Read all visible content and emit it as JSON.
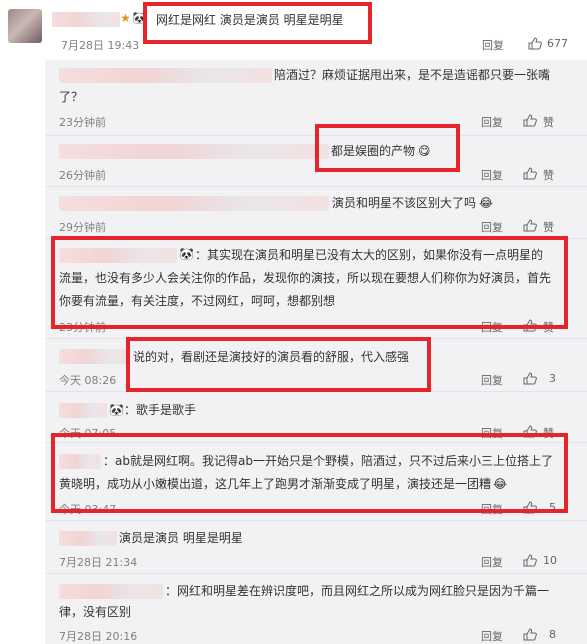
{
  "main_comment": {
    "emoji_icon": "panda-emoji",
    "text": "网红是网红 演员是演员 明星是明星",
    "time": "7月28日 19:43",
    "reply_label": "回复",
    "like_count": "677"
  },
  "replies": [
    {
      "text_line1": "陪酒过？麻烦证据甩出来，是不是造谣都只要一张嘴",
      "text_line2": "了？",
      "time": "23分钟前",
      "reply_label": "回复",
      "like_label": "赞"
    },
    {
      "text_line1": "都是娱圈的产物",
      "emoji": "😋",
      "time": "26分钟前",
      "reply_label": "回复",
      "like_label": "赞"
    },
    {
      "text_line1": "演员和明星不该区别大了吗",
      "emoji": "😂",
      "time": "29分钟前",
      "reply_label": "回复",
      "like_label": "赞"
    },
    {
      "text_line1": "：其实现在演员和明星已没有太大的区别，如果你没有一点明星的",
      "text_line2": "流量，也没有多少人会关注你的作品，发现你的演技，所以现在要想人们称你为好演员，首先",
      "text_line3": "你要有流量，有关注度，不过网红，呵呵，想都别想",
      "time": "23分钟前",
      "reply_label": "回复",
      "like_label": "赞"
    },
    {
      "text_line1": "说的对，看剧还是演技好的演员看的舒服，代入感强",
      "time": "今天 08:26",
      "reply_label": "回复",
      "like_count": "3"
    },
    {
      "text_line1": "：歌手是歌手",
      "time": "今天 07:05",
      "reply_label": "回复",
      "like_label": "赞"
    },
    {
      "text_line1": "：ab就是网红啊。我记得ab一开始只是个野模，陪酒过，只不过后来小三上位搭上了",
      "text_line2": "黄晓明，成功从小嫩模出道，这几年上了跑男才渐渐变成了明星，演技还是一团糟",
      "emoji": "😂",
      "time": "今天 03:47",
      "reply_label": "回复",
      "like_count": "5"
    },
    {
      "text_line1": "演员是演员  明星是明星",
      "time": "7月28日 21:34",
      "reply_label": "回复",
      "like_count": "10"
    },
    {
      "text_line1": "：网红和明星差在辨识度吧，而且网红之所以成为网红脸只是因为千篇一",
      "text_line2": "律，没有区别",
      "time": "7月28日 20:16",
      "reply_label": "回复",
      "like_count": "8"
    }
  ]
}
